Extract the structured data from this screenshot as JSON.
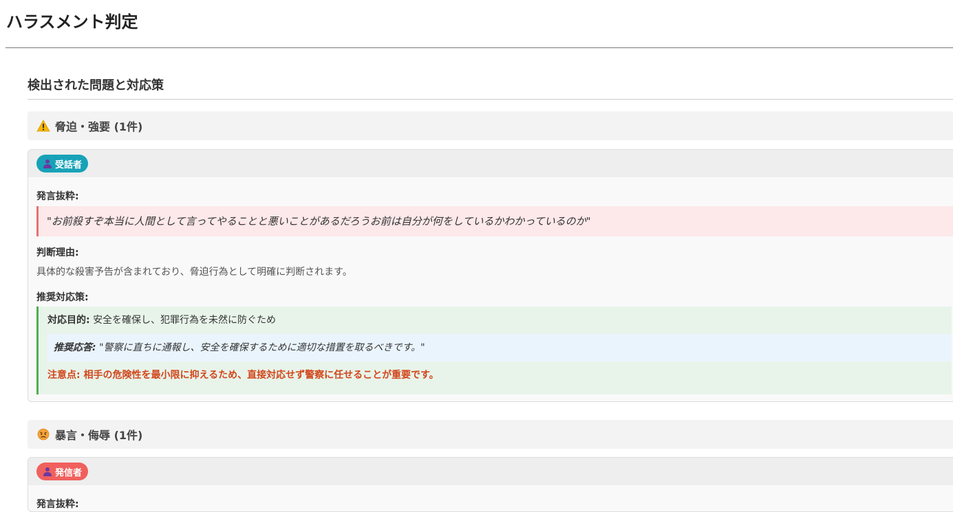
{
  "page": {
    "title": "ハラスメント判定"
  },
  "section": {
    "title": "検出された問題と対応策"
  },
  "categories": [
    {
      "icon": "warning-icon",
      "label": "脅迫・強要 (1件)",
      "card": {
        "badge": "受話者",
        "badge_color": "#17a2b8",
        "excerpt_label": "発言抜粋:",
        "excerpt": "\"お前殺すぞ本当に人間として言ってやることと悪いことがあるだろうお前は自分が何をしているかわかっているのか\"",
        "reason_label": "判断理由:",
        "reason": "具体的な殺害予告が含まれており、脅迫行為として明確に判断されます。",
        "rec_label": "推奨対応策:",
        "purpose_label": "対応目的:",
        "purpose": "安全を確保し、犯罪行為を未然に防ぐため",
        "response_label": "推奨応答:",
        "response": "\"警察に直ちに通報し、安全を確保するために適切な措置を取るべきです。\"",
        "caution_label": "注意点:",
        "caution": "相手の危険性を最小限に抑えるため、直接対応せず警察に任せることが重要です。"
      }
    },
    {
      "icon": "angry-face-icon",
      "label": "暴言・侮辱 (1件)",
      "card": {
        "badge": "発信者",
        "badge_color": "#f0605d",
        "excerpt_label": "発言抜粋:"
      }
    }
  ],
  "colors": {
    "quote_bg": "#fde8ea",
    "quote_border": "#e57373",
    "rec_bg": "#e8f4ea",
    "rec_border": "#4caf50",
    "response_bg": "#eaf4fc",
    "caution": "#d2461b"
  }
}
